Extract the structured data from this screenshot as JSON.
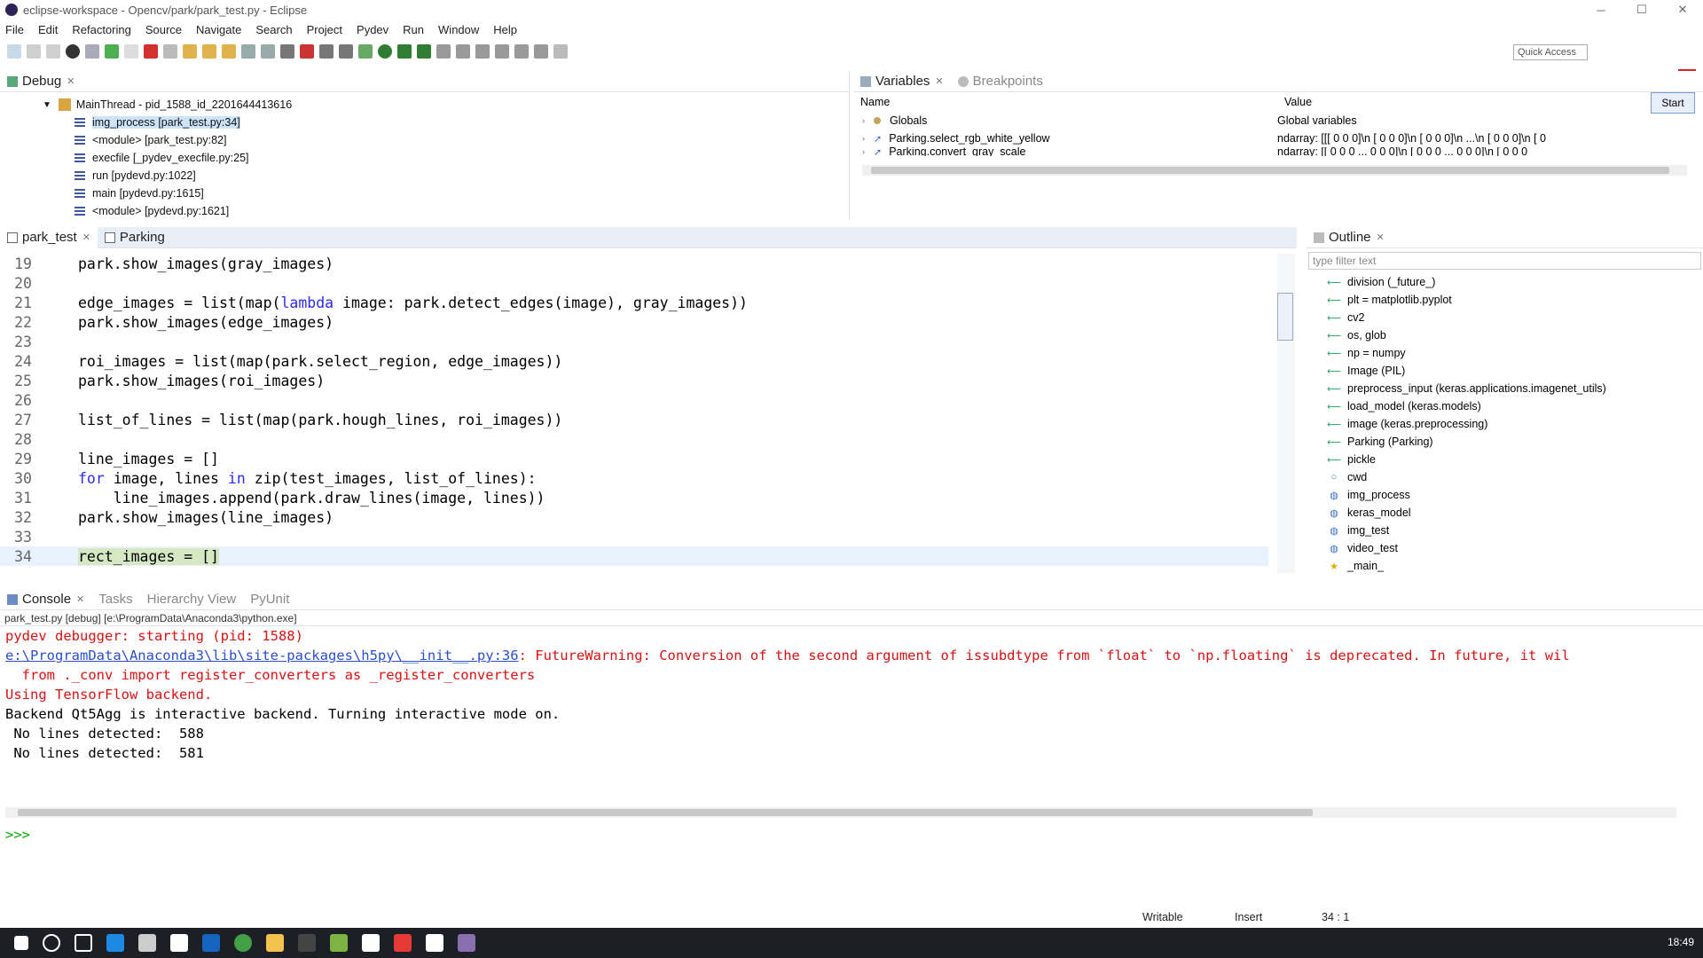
{
  "window": {
    "title": "eclipse-workspace - Opencv/park/park_test.py - Eclipse",
    "min": "─",
    "max": "☐",
    "close": "✕"
  },
  "menu": [
    "File",
    "Edit",
    "Refactoring",
    "Source",
    "Navigate",
    "Search",
    "Project",
    "Pydev",
    "Run",
    "Window",
    "Help"
  ],
  "quick_access": "Quick Access",
  "start_button": "Start",
  "debug": {
    "tab": "Debug",
    "thread": "MainThread - pid_1588_id_2201644413616",
    "frames": [
      "img_process [park_test.py:34]",
      "<module> [park_test.py:82]",
      "execfile [_pydev_execfile.py:25]",
      "run [pydevd.py:1022]",
      "main [pydevd.py:1615]",
      "<module> [pydevd.py:1621]"
    ]
  },
  "variables": {
    "tabs": [
      "Variables",
      "Breakpoints"
    ],
    "col_name": "Name",
    "col_value": "Value",
    "rows": [
      {
        "name": "Globals",
        "value": "Global variables"
      },
      {
        "name": "Parking.select_rgb_white_yellow",
        "value": "ndarray: [[[ 0  0  0]\\n [ 0  0  0]\\n [ 0  0  0]\\n ...\\n [ 0  0  0]\\n [ 0"
      },
      {
        "name": "Parking.convert_gray_scale",
        "value": "ndarray: [[ 0  0  0  ...  0  0  0]\\n [ 0  0  0  ...  0  0  0]\\n [ 0  0  0"
      }
    ]
  },
  "editor": {
    "tabs": [
      "park_test",
      "Parking"
    ],
    "lines": [
      {
        "n": "19",
        "code": "park.show_images(gray_images)"
      },
      {
        "n": "20",
        "code": ""
      },
      {
        "n": "21",
        "pre": "edge_images = list(map(",
        "kw": "lambda",
        "post": " image: park.detect_edges(image), gray_images))"
      },
      {
        "n": "22",
        "code": "park.show_images(edge_images)"
      },
      {
        "n": "23",
        "code": ""
      },
      {
        "n": "24",
        "code": "roi_images = list(map(park.select_region, edge_images))"
      },
      {
        "n": "25",
        "code": "park.show_images(roi_images)"
      },
      {
        "n": "26",
        "code": ""
      },
      {
        "n": "27",
        "code": "list_of_lines = list(map(park.hough_lines, roi_images))"
      },
      {
        "n": "28",
        "code": ""
      },
      {
        "n": "29",
        "code": "line_images = []"
      },
      {
        "n": "30",
        "kw1": "for",
        "mid1": " image, lines ",
        "kw2": "in",
        "post2": " zip(test_images, list_of_lines):"
      },
      {
        "n": "31",
        "code": "    line_images.append(park.draw_lines(image, lines))"
      },
      {
        "n": "32",
        "code": "park.show_images(line_images)"
      },
      {
        "n": "33",
        "code": ""
      },
      {
        "n": "34",
        "code": "rect_images = []"
      }
    ]
  },
  "outline": {
    "tab": "Outline",
    "filter_placeholder": "type filter text",
    "items": [
      {
        "label": "division (_future_)",
        "icon": "import-icon"
      },
      {
        "label": "plt = matplotlib.pyplot",
        "icon": "import-icon"
      },
      {
        "label": "cv2",
        "icon": "import-icon"
      },
      {
        "label": "os, glob",
        "icon": "import-icon"
      },
      {
        "label": "np = numpy",
        "icon": "import-icon"
      },
      {
        "label": "Image (PIL)",
        "icon": "import-icon"
      },
      {
        "label": "preprocess_input (keras.applications.imagenet_utils)",
        "icon": "import-icon"
      },
      {
        "label": "load_model (keras.models)",
        "icon": "import-icon"
      },
      {
        "label": "image (keras.preprocessing)",
        "icon": "import-icon"
      },
      {
        "label": "Parking (Parking)",
        "icon": "import-icon"
      },
      {
        "label": "pickle",
        "icon": "import-icon"
      },
      {
        "label": "cwd",
        "icon": "variable-icon"
      },
      {
        "label": "img_process",
        "icon": "function-icon"
      },
      {
        "label": "keras_model",
        "icon": "function-icon"
      },
      {
        "label": "img_test",
        "icon": "function-icon"
      },
      {
        "label": "video_test",
        "icon": "function-icon"
      },
      {
        "label": "_main_",
        "icon": "main-icon"
      }
    ]
  },
  "console": {
    "tabs": [
      "Console",
      "Tasks",
      "Hierarchy View",
      "PyUnit"
    ],
    "subtitle": "park_test.py [debug] [e:\\ProgramData\\Anaconda3\\python.exe]",
    "line1": "pydev debugger: starting (pid: 1588)",
    "link": "e:\\ProgramData\\Anaconda3\\lib\\site-packages\\h5py\\__init__.py:36",
    "warn": ": FutureWarning: Conversion of the second argument of issubdtype from `float` to `np.floating` is deprecated. In future, it wil",
    "line3": "  from ._conv import register_converters as _register_converters",
    "line4": "Using TensorFlow backend.",
    "line5": "Backend Qt5Agg is interactive backend. Turning interactive mode on.",
    "line6": " No lines detected:  588",
    "line7": " No lines detected:  581",
    "prompt": ">>>"
  },
  "status": {
    "mode": "Writable",
    "insert": "Insert",
    "position": "34 : 1"
  },
  "taskbar": {
    "time": "18:49"
  }
}
